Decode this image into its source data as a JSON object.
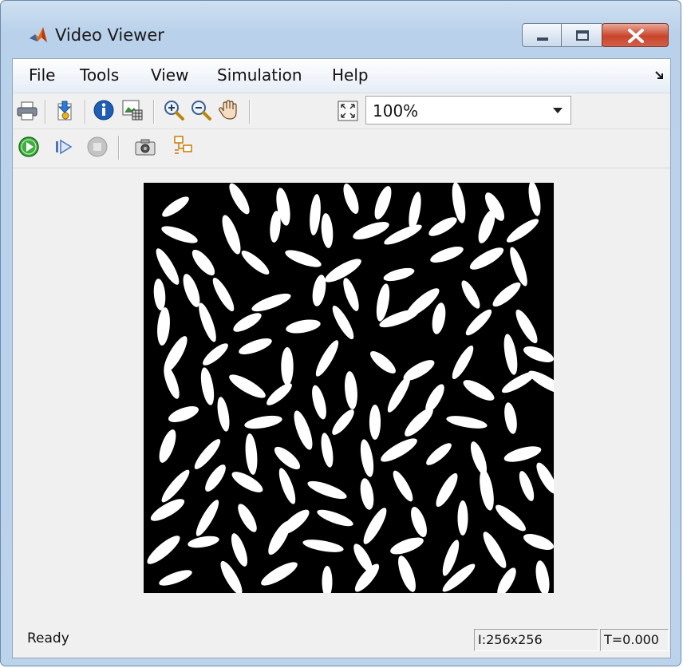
{
  "window": {
    "title": "Video Viewer"
  },
  "menu": [
    {
      "label": "File"
    },
    {
      "label": "Tools"
    },
    {
      "label": "View"
    },
    {
      "label": "Simulation"
    },
    {
      "label": "Help"
    }
  ],
  "toolbar": {
    "zoom": {
      "value": "100%"
    },
    "icons_row1": [
      "print-icon",
      "export-icon",
      "info-icon",
      "pixel-region-icon",
      "zoom-in-icon",
      "zoom-out-icon",
      "pan-hand-icon",
      "fit-to-view-icon"
    ],
    "icons_row2": [
      "play-icon",
      "step-forward-icon",
      "stop-icon",
      "snapshot-icon",
      "highlight-block-icon"
    ]
  },
  "status": {
    "text": "Ready",
    "dimensions": "I:256x256",
    "time": "T=0.000"
  },
  "colors": {
    "frame_background": "#000000",
    "grain": "#ffffff"
  }
}
